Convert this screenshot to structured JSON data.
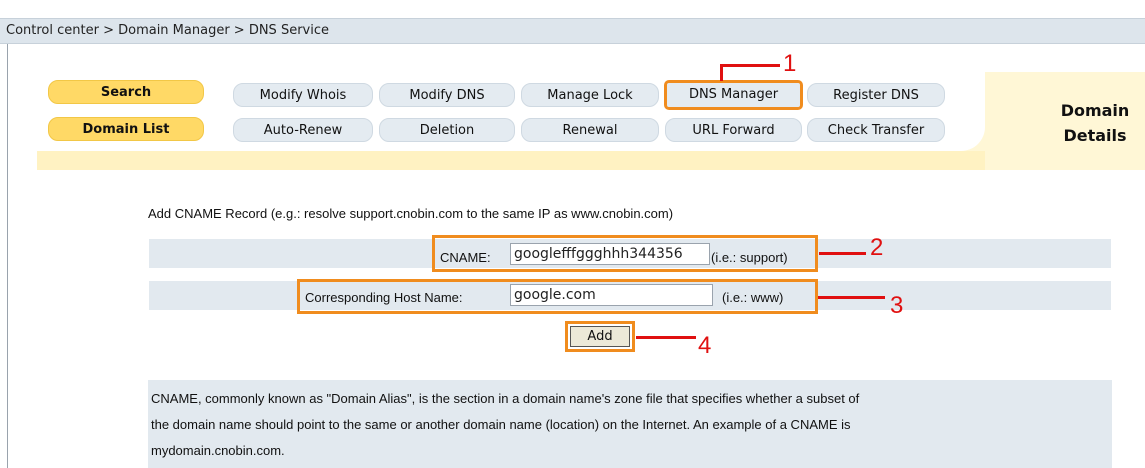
{
  "breadcrumb": "Control center > Domain Manager > DNS Service",
  "nav": {
    "search": "Search",
    "domain_list": "Domain List",
    "modify_whois": "Modify Whois",
    "modify_dns": "Modify DNS",
    "manage_lock": "Manage Lock",
    "dns_manager": "DNS Manager",
    "register_dns": "Register DNS",
    "auto_renew": "Auto-Renew",
    "deletion": "Deletion",
    "renewal": "Renewal",
    "url_forward": "URL Forward",
    "check_transfer": "Check Transfer",
    "details_line1": "Domain",
    "details_line2": "Details"
  },
  "form": {
    "title": "Add CNAME Record (e.g.: resolve support.cnobin.com to the same IP as www.cnobin.com)",
    "cname_label": "CNAME:",
    "cname_value": "googlefffggghhh344356",
    "cname_hint": "(i.e.: support)",
    "host_label": "Corresponding Host Name:",
    "host_value": "google.com",
    "host_hint": "(i.e.: www)",
    "add_label": "Add"
  },
  "callouts": {
    "c1": "1",
    "c2": "2",
    "c3": "3",
    "c4": "4"
  },
  "description": {
    "line1": "CNAME, commonly known as \"Domain Alias\", is the section in a domain name's zone file that specifies whether a subset of",
    "line2": "the domain name should point to the same or another domain name (location) on the Internet. An example of a CNAME is",
    "line3": "mydomain.cnobin.com."
  },
  "colors": {
    "highlight": "#f08c1e",
    "callout": "#e01010",
    "nav_yellow": "#ffd966",
    "nav_blue": "#e4ebf1",
    "panel": "#fff7d6"
  }
}
